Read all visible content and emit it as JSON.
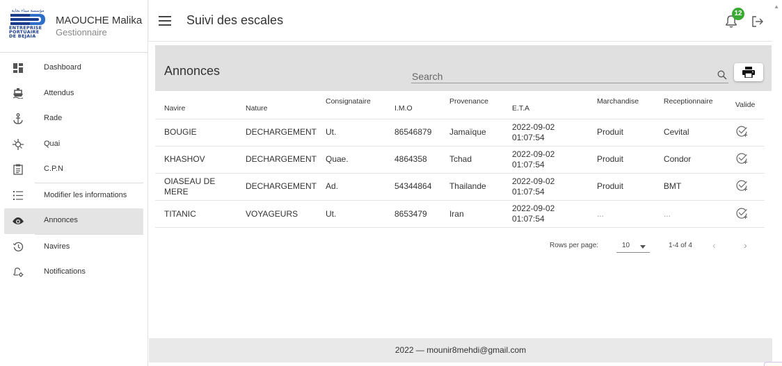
{
  "profile": {
    "logo_arabic": "مؤسسة ميناء بجاية",
    "logo_lines": [
      "ENTREPRISE",
      "PORTUAIRE",
      "DE BEJAIA"
    ],
    "name": "MAOUCHE Malika",
    "role": "Gestionnaire"
  },
  "nav": [
    {
      "label": "Dashboard",
      "icon": "dashboard-icon"
    },
    {
      "label": "Attendus",
      "icon": "ship-icon"
    },
    {
      "label": "Rade",
      "icon": "anchor-icon"
    },
    {
      "label": "Quai",
      "icon": "dock-icon"
    },
    {
      "label": "C.P.N",
      "icon": "clipboard-icon"
    },
    {
      "label": "Modifier les informations",
      "icon": "list-edit-icon"
    },
    {
      "label": "Annonces",
      "icon": "eye-icon"
    },
    {
      "label": "Navires",
      "icon": "history-icon"
    },
    {
      "label": "Notifications",
      "icon": "bell-settings-icon"
    }
  ],
  "header": {
    "title": "Suivi des escales",
    "notification_count": "12"
  },
  "card": {
    "title": "Annonces",
    "search_label": "Search"
  },
  "table": {
    "columns": [
      "Navire",
      "Nature",
      "Consignataire",
      "I.M.O",
      "Provenance",
      "E.T.A",
      "Marchandise",
      "Receptionnaire",
      "Valide"
    ],
    "rows": [
      {
        "navire": "BOUGIE",
        "nature": "DECHARGEMENT",
        "consignataire": "Ut.",
        "imo": "86546879",
        "provenance": "Jamaïque",
        "eta_date": "2022-09-02",
        "eta_time": "01:07:54",
        "marchandise": "Produit",
        "receptionnaire": "Cevital"
      },
      {
        "navire": "KHASHOV",
        "nature": "DECHARGEMENT",
        "consignataire": "Quae.",
        "imo": "4864358",
        "provenance": "Tchad",
        "eta_date": "2022-09-02",
        "eta_time": "01:07:54",
        "marchandise": "Produit",
        "receptionnaire": "Condor"
      },
      {
        "navire": "OIASEAU DE MERE",
        "nature": "DECHARGEMENT",
        "consignataire": "Ad.",
        "imo": "54344864",
        "provenance": "Thailande",
        "eta_date": "2022-09-02",
        "eta_time": "01:07:54",
        "marchandise": "Produit",
        "receptionnaire": "BMT"
      },
      {
        "navire": "TITANIC",
        "nature": "VOYAGEURS",
        "consignataire": "Ut.",
        "imo": "8653479",
        "provenance": "Iran",
        "eta_date": "2022-09-02",
        "eta_time": "01:07:54",
        "marchandise": "...",
        "receptionnaire": "..."
      }
    ]
  },
  "pagination": {
    "rows_per_page_label": "Rows per page:",
    "rows_per_page_value": "10",
    "range": "1-4 of 4"
  },
  "footer": {
    "text": "2022 — mounir8mehdi@gmail.com"
  },
  "colors": {
    "badge": "#3aaa35",
    "logo_blue": "#1b3c8a",
    "header_band": "#e0e0e0"
  }
}
